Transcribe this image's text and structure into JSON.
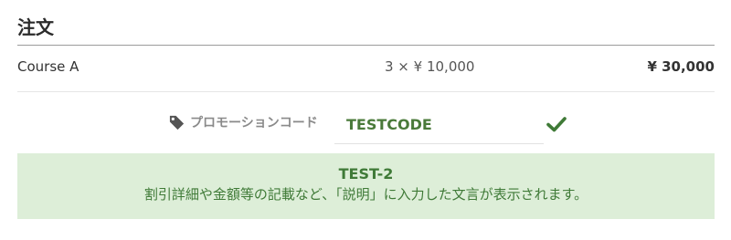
{
  "order": {
    "title": "注文",
    "item": {
      "name": "Course A",
      "quantity_price": "3 × ¥ 10,000",
      "total": "¥ 30,000"
    }
  },
  "promotion": {
    "label": "プロモーションコード",
    "code_value": "TESTCODE",
    "applied": {
      "name": "TEST-2",
      "description": "割引詳細や金額等の記載など、「説明」に入力した文言が表示されます。"
    }
  },
  "icons": {
    "tag": "tag-icon",
    "check": "check-icon"
  },
  "colors": {
    "success_text": "#3f7a37",
    "success_background": "#ddeed8",
    "check": "#3f7a37",
    "label": "#8a8a8a"
  }
}
